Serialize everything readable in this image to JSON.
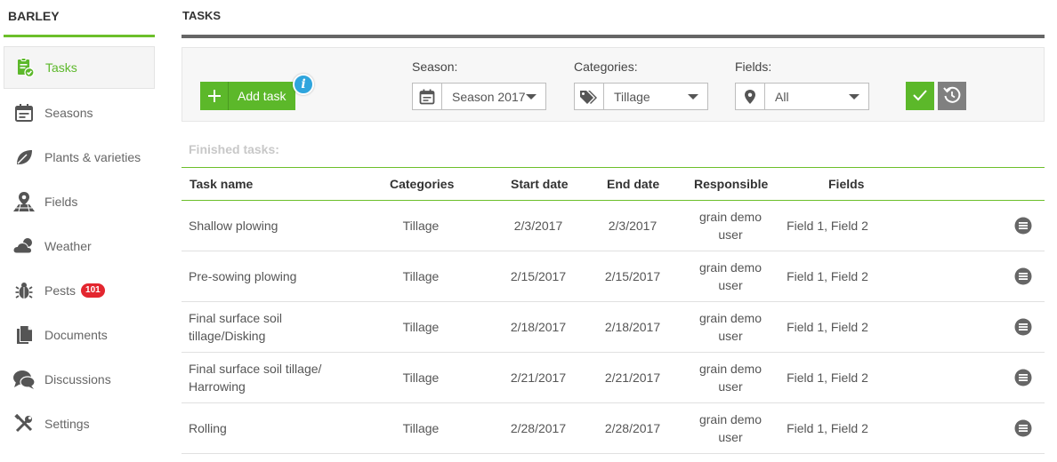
{
  "sidebar": {
    "title": "BARLEY",
    "items": [
      {
        "label": "Tasks",
        "icon": "clipboard-check-icon",
        "active": true
      },
      {
        "label": "Seasons",
        "icon": "calendar-icon"
      },
      {
        "label": "Plants & varieties",
        "icon": "leaf-icon"
      },
      {
        "label": "Fields",
        "icon": "field-pin-icon"
      },
      {
        "label": "Weather",
        "icon": "cloud-sun-icon"
      },
      {
        "label": "Pests",
        "icon": "bug-icon",
        "badge": "101"
      },
      {
        "label": "Documents",
        "icon": "document-icon"
      },
      {
        "label": "Discussions",
        "icon": "chat-icon"
      },
      {
        "label": "Settings",
        "icon": "tools-icon"
      }
    ]
  },
  "main": {
    "title": "TASKS",
    "add_task_label": "Add task",
    "filters": {
      "season_label": "Season:",
      "season_value": "Season 2017",
      "categories_label": "Categories:",
      "categories_value": "Tillage",
      "fields_label": "Fields:",
      "fields_value": "All"
    },
    "finished_label": "Finished tasks:",
    "columns": [
      "Task name",
      "Categories",
      "Start date",
      "End date",
      "Responsible",
      "Fields"
    ],
    "rows": [
      {
        "name": "Shallow plowing",
        "category": "Tillage",
        "start": "2/3/2017",
        "end": "2/3/2017",
        "responsible": "grain demo user",
        "fields": "Field 1, Field 2"
      },
      {
        "name": "Pre-sowing plowing",
        "category": "Tillage",
        "start": "2/15/2017",
        "end": "2/15/2017",
        "responsible": "grain demo user",
        "fields": "Field 1, Field 2"
      },
      {
        "name": "Final surface soil tillage/Disking",
        "category": "Tillage",
        "start": "2/18/2017",
        "end": "2/18/2017",
        "responsible": "grain demo user",
        "fields": "Field 1, Field 2"
      },
      {
        "name": "Final surface soil tillage/ Harrowing",
        "category": "Tillage",
        "start": "2/21/2017",
        "end": "2/21/2017",
        "responsible": "grain demo user",
        "fields": "Field 1, Field 2"
      },
      {
        "name": "Rolling",
        "category": "Tillage",
        "start": "2/28/2017",
        "end": "2/28/2017",
        "responsible": "grain demo user",
        "fields": "Field 1, Field 2"
      }
    ]
  },
  "colors": {
    "accent": "#5cb82a",
    "badge": "#e3262f",
    "info": "#2fa5dd",
    "reset": "#808080"
  }
}
